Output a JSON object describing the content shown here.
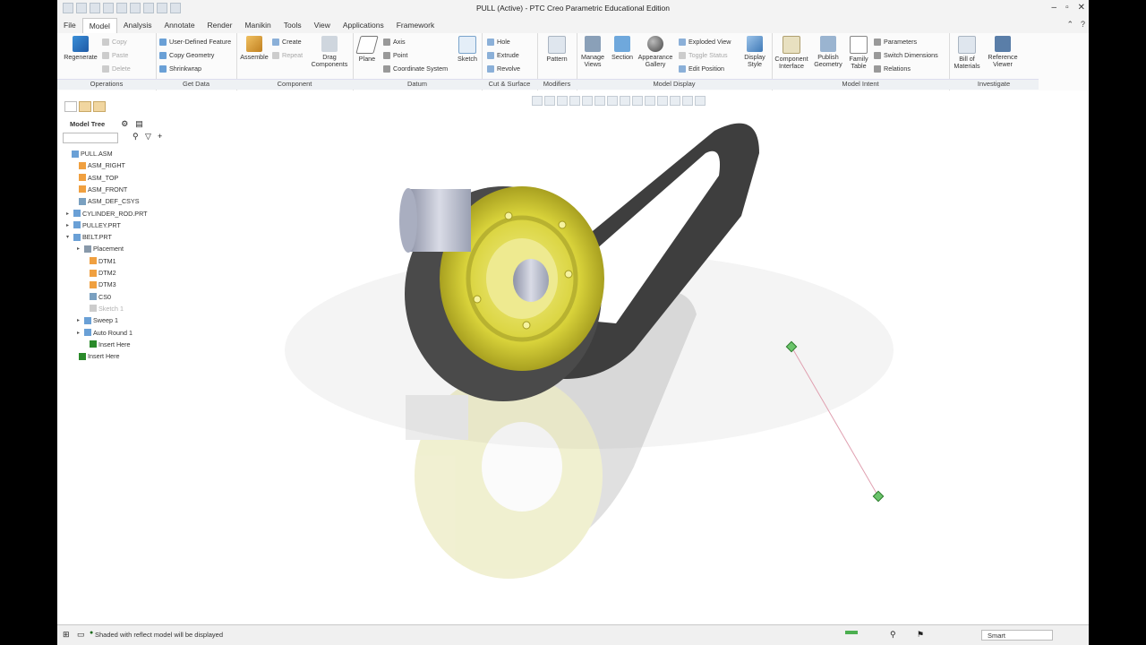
{
  "window": {
    "title": "PULL (Active) - PTC Creo Parametric Educational Edition"
  },
  "tabs": [
    "File",
    "Model",
    "Analysis",
    "Annotate",
    "Render",
    "Manikin",
    "Tools",
    "View",
    "Applications",
    "Framework"
  ],
  "active_tab": "Model",
  "ribbon": {
    "operations": {
      "label": "Operations",
      "regenerate": "Regenerate",
      "copy": "Copy",
      "paste": "Paste",
      "delete": "Delete"
    },
    "get_data": {
      "label": "Get Data",
      "udf": "User-Defined Feature",
      "copy_geometry": "Copy Geometry",
      "shrinkwrap": "Shrinkwrap"
    },
    "component": {
      "label": "Component",
      "assemble": "Assemble",
      "create": "Create",
      "repeat": "Repeat",
      "drag": "Drag Components"
    },
    "datum": {
      "label": "Datum",
      "plane": "Plane",
      "axis": "Axis",
      "point": "Point",
      "coordinate_system": "Coordinate System",
      "sketch": "Sketch"
    },
    "cut_surface": {
      "label": "Cut & Surface",
      "hole": "Hole",
      "extrude": "Extrude",
      "revolve": "Revolve"
    },
    "modifiers": {
      "label": "Modifiers",
      "pattern": "Pattern"
    },
    "model_display": {
      "label": "Model Display",
      "manage_views": "Manage Views",
      "section": "Section",
      "appearance_gallery": "Appearance Gallery",
      "exploded_view": "Exploded View",
      "toggle_status": "Toggle Status",
      "edit_position": "Edit Position",
      "display_style": "Display Style"
    },
    "model_intent": {
      "label": "Model Intent",
      "component_interface": "Component Interface",
      "publish_geometry": "Publish Geometry",
      "family_table": "Family Table",
      "parameters": "Parameters",
      "switch_dimensions": "Switch Dimensions",
      "relations": "Relations"
    },
    "investigate": {
      "label": "Investigate",
      "bill_of_materials": "Bill of Materials",
      "reference_viewer": "Reference Viewer"
    }
  },
  "model_tree": {
    "header": "Model Tree",
    "items": [
      {
        "label": "PULL.ASM",
        "muted": false
      },
      {
        "label": "ASM_RIGHT",
        "muted": false
      },
      {
        "label": "ASM_TOP",
        "muted": false
      },
      {
        "label": "ASM_FRONT",
        "muted": false
      },
      {
        "label": "ASM_DEF_CSYS",
        "muted": false
      },
      {
        "label": "CYLINDER_ROD.PRT",
        "muted": false
      },
      {
        "label": "PULLEY.PRT",
        "muted": false
      },
      {
        "label": "BELT.PRT",
        "muted": false
      },
      {
        "label": "Placement",
        "muted": false
      },
      {
        "label": "DTM1",
        "muted": false
      },
      {
        "label": "DTM2",
        "muted": false
      },
      {
        "label": "DTM3",
        "muted": false
      },
      {
        "label": "CS0",
        "muted": false
      },
      {
        "label": "Sketch 1",
        "muted": true
      },
      {
        "label": "Sweep 1",
        "muted": false
      },
      {
        "label": "Auto Round 1",
        "muted": false
      },
      {
        "label": "Insert Here",
        "muted": false
      },
      {
        "label": "Insert Here",
        "muted": false
      }
    ]
  },
  "status": {
    "message": "Shaded with reflect model will be displayed",
    "filter_value": "Smart"
  },
  "colors": {
    "belt": "#4a4a4a",
    "pulley": "#d8d23a",
    "accent": "#1f5aa6"
  }
}
